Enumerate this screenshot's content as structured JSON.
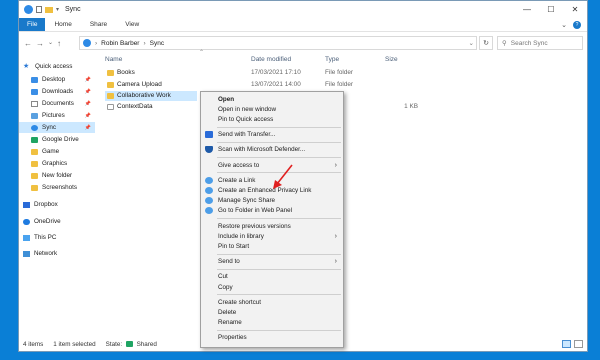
{
  "window": {
    "title": "Sync",
    "controls": {
      "minimize": "—",
      "maximize": "☐",
      "close": "✕"
    }
  },
  "ribbon": {
    "tabs": [
      "File",
      "Home",
      "Share",
      "View"
    ]
  },
  "address": {
    "crumbs": [
      "Robin Barber",
      "Sync"
    ],
    "search_placeholder": "Search Sync"
  },
  "nav": {
    "items": [
      {
        "label": "Quick access",
        "icon": "star-icon"
      },
      {
        "label": "Desktop",
        "icon": "desktop-icon",
        "pinned": true
      },
      {
        "label": "Downloads",
        "icon": "downloads-icon",
        "pinned": true
      },
      {
        "label": "Documents",
        "icon": "documents-icon",
        "pinned": true
      },
      {
        "label": "Pictures",
        "icon": "pictures-icon",
        "pinned": true
      },
      {
        "label": "Sync",
        "icon": "sync-icon",
        "pinned": true,
        "active": true
      },
      {
        "label": "Google Drive",
        "icon": "google-drive-icon"
      },
      {
        "label": "Game",
        "icon": "folder-icon"
      },
      {
        "label": "Graphics",
        "icon": "folder-icon"
      },
      {
        "label": "New folder",
        "icon": "folder-icon"
      },
      {
        "label": "Screenshots",
        "icon": "folder-icon"
      },
      {
        "label": "Dropbox",
        "icon": "dropbox-icon"
      },
      {
        "label": "OneDrive",
        "icon": "onedrive-icon"
      },
      {
        "label": "This PC",
        "icon": "this-pc-icon"
      },
      {
        "label": "Network",
        "icon": "network-icon"
      }
    ]
  },
  "columns": {
    "name": "Name",
    "date": "Date modified",
    "type": "Type",
    "size": "Size"
  },
  "files": [
    {
      "name": "Books",
      "date": "17/03/2021 17:10",
      "type": "File folder",
      "size": ""
    },
    {
      "name": "Camera Upload",
      "date": "13/07/2021 14:00",
      "type": "File folder",
      "size": ""
    },
    {
      "name": "Collaborative Work",
      "date": "",
      "type": "",
      "size": "",
      "selected": true
    },
    {
      "name": "ContextData",
      "date": "",
      "type": "",
      "size": "1 KB"
    }
  ],
  "status": {
    "items": "4 items",
    "selected": "1 item selected",
    "state_label": "State:",
    "state_value": "Shared"
  },
  "context_menu": {
    "items": [
      {
        "label": "Open",
        "bold": true
      },
      {
        "label": "Open in new window"
      },
      {
        "label": "Pin to Quick access"
      },
      {
        "sep": true
      },
      {
        "label": "Send with Transfer...",
        "icon": "dropbox-icon"
      },
      {
        "sep": true
      },
      {
        "label": "Scan with Microsoft Defender...",
        "icon": "defender-shield-icon"
      },
      {
        "sep": true
      },
      {
        "label": "Give access to",
        "submenu": true
      },
      {
        "sep": true
      },
      {
        "label": "Create a Link",
        "icon": "sync-icon"
      },
      {
        "label": "Create an Enhanced Privacy Link",
        "icon": "sync-icon"
      },
      {
        "label": "Manage Sync Share",
        "icon": "sync-icon"
      },
      {
        "label": "Go to Folder in Web Panel",
        "icon": "sync-icon"
      },
      {
        "sep": true
      },
      {
        "label": "Restore previous versions"
      },
      {
        "label": "Include in library",
        "submenu": true
      },
      {
        "label": "Pin to Start"
      },
      {
        "sep": true
      },
      {
        "label": "Send to",
        "submenu": true
      },
      {
        "sep": true
      },
      {
        "label": "Cut"
      },
      {
        "label": "Copy"
      },
      {
        "sep": true
      },
      {
        "label": "Create shortcut"
      },
      {
        "label": "Delete"
      },
      {
        "label": "Rename"
      },
      {
        "sep": true
      },
      {
        "label": "Properties"
      }
    ]
  },
  "colors": {
    "desktop": "#0a7fd6",
    "accent": "#1979ca",
    "selection": "#cce8ff",
    "annotation_arrow": "#e02020"
  }
}
